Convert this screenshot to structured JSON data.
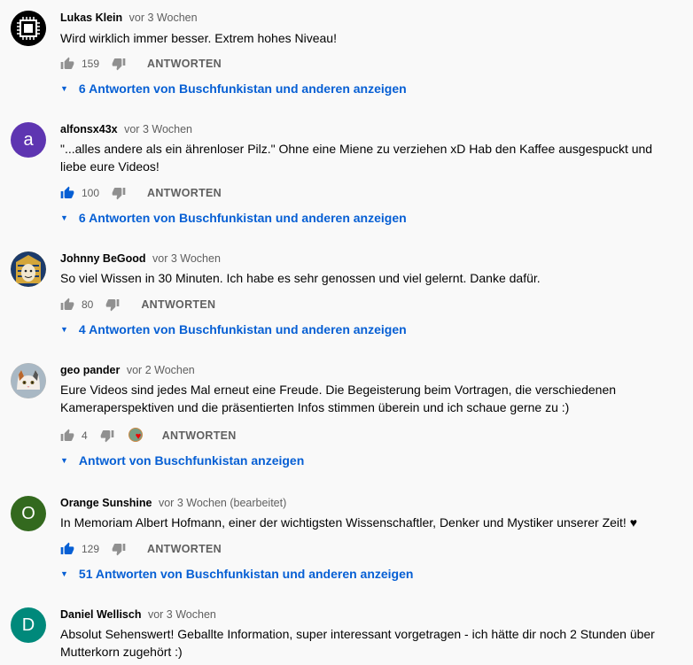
{
  "comments": [
    {
      "author": "Lukas Klein",
      "time": "vor 3 Wochen",
      "text": "Wird wirklich immer besser. Extrem hohes Niveau!",
      "likes": "159",
      "reply_label": "ANTWORTEN",
      "replies_label": "6 Antworten von Buschfunkistan und anderen anzeigen",
      "avatar_color": "#000000"
    },
    {
      "author": "alfonsx43x",
      "time": "vor 3 Wochen",
      "text": "\"...alles andere als ein ährenloser Pilz.\" Ohne eine Miene zu verziehen xD Hab den Kaffee ausgespuckt und liebe eure Videos!",
      "likes": "100",
      "liked": true,
      "reply_label": "ANTWORTEN",
      "replies_label": "6 Antworten von Buschfunkistan und anderen anzeigen",
      "avatar_letter": "a",
      "avatar_color": "#5e35b1"
    },
    {
      "author": "Johnny BeGood",
      "time": "vor 3 Wochen",
      "text": "So viel Wissen in 30 Minuten. Ich habe es sehr genossen und viel gelernt. Danke dafür.",
      "likes": "80",
      "reply_label": "ANTWORTEN",
      "replies_label": "4 Antworten von Buschfunkistan und anderen anzeigen",
      "avatar_color": "#c9a24a"
    },
    {
      "author": "geo pander",
      "time": "vor 2 Wochen",
      "text": "Eure Videos sind jedes Mal erneut eine Freude. Die Begeisterung beim Vortragen, die verschiedenen Kameraperspektiven und die präsentierten Infos stimmen überein und ich schaue gerne zu  :)",
      "likes": "4",
      "reply_label": "ANTWORTEN",
      "replies_label": "Antwort von Buschfunkistan anzeigen",
      "avatar_color": "#d7b79a"
    },
    {
      "author": "Orange Sunshine",
      "time": "vor 3 Wochen (bearbeitet)",
      "text": "In Memoriam Albert Hofmann, einer der wichtigsten Wissenschaftler, Denker und Mystiker unserer Zeit! ♥",
      "likes": "129",
      "liked": true,
      "reply_label": "ANTWORTEN",
      "replies_label": "51 Antworten von Buschfunkistan und anderen anzeigen",
      "avatar_letter": "O",
      "avatar_color": "#33691e"
    },
    {
      "author": "Daniel Wellisch",
      "time": "vor 3 Wochen",
      "text": "Absolut Sehenswert! Geballte Information, super interessant vorgetragen - ich hätte dir noch 2 Stunden über Mutterkorn zugehört :)",
      "avatar_letter": "D",
      "avatar_color": "#00897b"
    }
  ],
  "colors": {
    "link": "#065fd4",
    "liked": "#065fd4",
    "muted": "#606060",
    "heart": "#e00000"
  }
}
